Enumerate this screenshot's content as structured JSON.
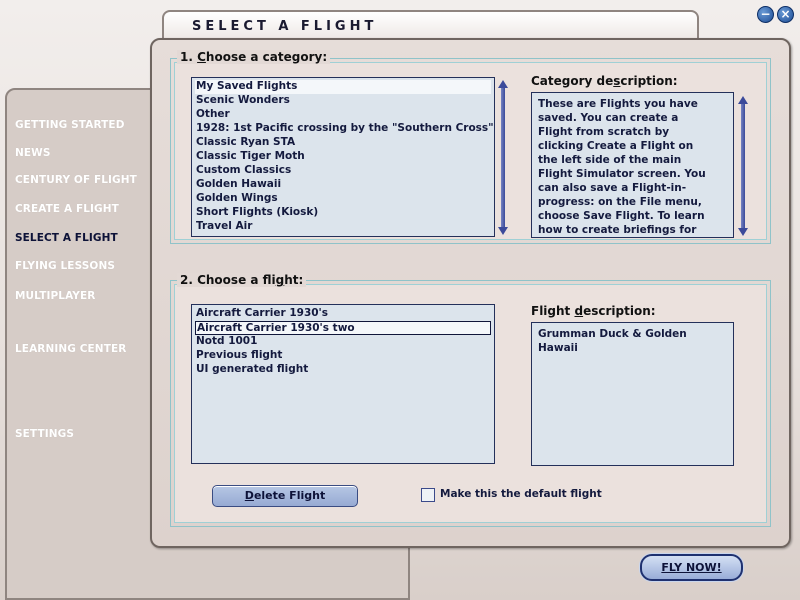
{
  "window": {
    "minimize_symbol": "−",
    "close_symbol": "×"
  },
  "title": "SELECT A FLIGHT",
  "nav": {
    "items": [
      {
        "label": "GETTING STARTED"
      },
      {
        "label": "NEWS"
      },
      {
        "label": "CENTURY OF FLIGHT"
      },
      {
        "label": "CREATE A FLIGHT"
      },
      {
        "label": "SELECT A FLIGHT"
      },
      {
        "label": "FLYING LESSONS"
      },
      {
        "label": "MULTIPLAYER"
      },
      {
        "label": "LEARNING CENTER"
      },
      {
        "label": "SETTINGS"
      }
    ],
    "active_index": 4
  },
  "category_section": {
    "legend_prefix": "1. ",
    "legend_hot": "C",
    "legend_rest": "hoose a category:",
    "items": [
      "My Saved Flights",
      "Scenic Wonders",
      "Other",
      "1928: 1st Pacific crossing by the \"Southern Cross\"",
      "Classic Ryan STA",
      "Classic Tiger Moth",
      "Custom Classics",
      "Golden Hawaii",
      "Golden Wings",
      "Short Flights (Kiosk)",
      "Travel Air"
    ],
    "selected_index": 0,
    "description_label_pre": "Category de",
    "description_label_hot": "s",
    "description_label_post": "cription:",
    "description": "These are Flights you have saved. You can create a Flight from scratch by clicking Create a Flight on the left side of the main Flight Simulator screen. You can also save a Flight-in-progress: on the File menu, choose Save Flight. To learn how to create briefings for your Flights or new categories of"
  },
  "flight_section": {
    "legend_prefix": "2. Choose a fli",
    "legend_hot": "g",
    "legend_rest": "ht:",
    "items": [
      "Aircraft Carrier 1930's",
      "Aircraft Carrier 1930's two",
      "Notd 1001",
      "Previous flight",
      "UI generated flight"
    ],
    "focused_index": 1,
    "description_label_pre": "Flight ",
    "description_label_hot": "d",
    "description_label_post": "escription:",
    "description": "Grumman Duck & Golden Hawaii"
  },
  "actions": {
    "delete_hot": "D",
    "delete_rest": "elete Flight",
    "default_checkbox_label": "Make this the default flight",
    "default_checked": false,
    "fly_now": "FLY NOW!"
  }
}
